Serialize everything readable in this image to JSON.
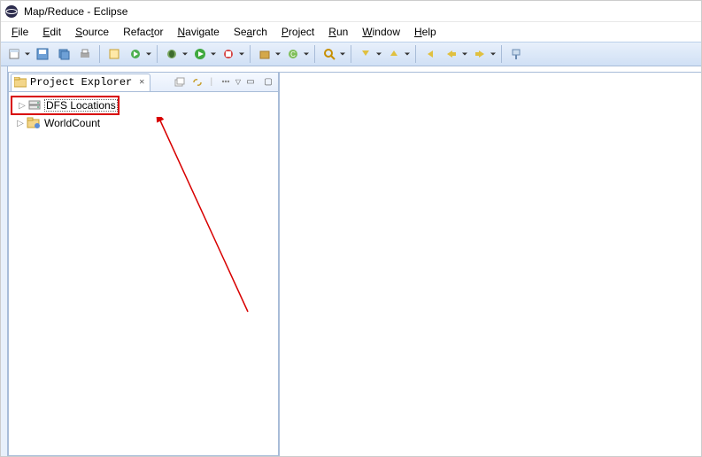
{
  "window": {
    "title": "Map/Reduce - Eclipse"
  },
  "menu": {
    "file": {
      "label": "File",
      "mn": "F"
    },
    "edit": {
      "label": "Edit",
      "mn": "E"
    },
    "source": {
      "label": "Source",
      "mn": "S"
    },
    "refactor": {
      "label": "Refactor",
      "mn": "t"
    },
    "navigate": {
      "label": "Navigate",
      "mn": "N"
    },
    "search": {
      "label": "Search",
      "mn": "a"
    },
    "project": {
      "label": "Project",
      "mn": "P"
    },
    "run": {
      "label": "Run",
      "mn": "R"
    },
    "window": {
      "label": "Window",
      "mn": "W"
    },
    "help": {
      "label": "Help",
      "mn": "H"
    }
  },
  "view": {
    "title": "Project Explorer",
    "items": [
      {
        "label": "DFS Locations"
      },
      {
        "label": "WorldCount"
      }
    ]
  }
}
